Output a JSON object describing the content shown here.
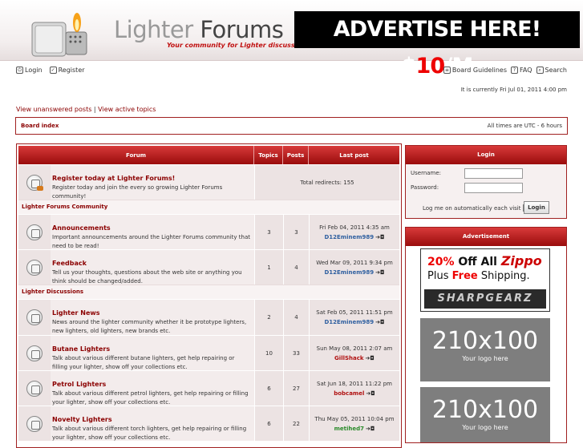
{
  "header": {
    "logo_word1": "Lighter",
    "logo_word2": "Forums",
    "tagline": "Your community for Lighter discussions!",
    "ad_text_pre": "ADVERTISE HERE! $",
    "ad_text_hl": "10",
    "ad_text_post": "/M"
  },
  "nav": {
    "login": "Login",
    "register": "Register",
    "guidelines": "Board Guidelines",
    "faq": "FAQ",
    "search": "Search"
  },
  "current_time": "It is currently Fri Jul 01, 2011 4:00 pm",
  "quick_links": {
    "unanswered": "View unanswered posts",
    "separator": "|",
    "active": "View active topics"
  },
  "crumb": {
    "board_index": "Board index",
    "timezone": "All times are UTC - 6 hours"
  },
  "table": {
    "headers": {
      "forum": "Forum",
      "topics": "Topics",
      "posts": "Posts",
      "last": "Last post"
    },
    "register": {
      "title": "Register today at Lighter Forums!",
      "desc": "Register today and join the every so growing Lighter Forums community!",
      "redirects": "Total redirects: 155"
    },
    "cat1": "Lighter Forums Community",
    "cat2": "Lighter Discussions",
    "forums": [
      {
        "title": "Announcements",
        "desc": "Important announcements around the Lighter Forums community that need to be read!",
        "topics": "3",
        "posts": "3",
        "date": "Fri Feb 04, 2011 4:35 am",
        "by": "D12Eminem989"
      },
      {
        "title": "Feedback",
        "desc": "Tell us your thoughts, questions about the web site or anything you think should be changed/added.",
        "topics": "1",
        "posts": "4",
        "date": "Wed Mar 09, 2011 9:34 pm",
        "by": "D12Eminem989"
      },
      {
        "title": "Lighter News",
        "desc": "News around the lighter community whether it be prototype lighters, new lighters, old lighters, new brands etc.",
        "topics": "2",
        "posts": "4",
        "date": "Sat Feb 05, 2011 11:51 pm",
        "by": "D12Eminem989"
      },
      {
        "title": "Butane Lighters",
        "desc": "Talk about various different butane lighters, get help repairing or filling your lighter, show off your collections etc.",
        "topics": "10",
        "posts": "33",
        "date": "Sun May 08, 2011 2:07 am",
        "by": "GillShack"
      },
      {
        "title": "Petrol Lighters",
        "desc": "Talk about various different petrol lighters, get help repairing or filling your lighter, show off your collections etc.",
        "topics": "6",
        "posts": "27",
        "date": "Sat Jun 18, 2011 11:22 pm",
        "by": "bobcamel"
      },
      {
        "title": "Novelty Lighters",
        "desc": "Talk about various different torch lighters, get help repairing or filling your lighter, show off your collections etc.",
        "topics": "6",
        "posts": "22",
        "date": "Thu May 05, 2011 10:04 pm",
        "by": "metihed7"
      }
    ]
  },
  "login_box": {
    "title": "Login",
    "username_label": "Username:",
    "password_label": "Password:",
    "auto_label": "Log me on automatically each visit",
    "button": "Login"
  },
  "advert": {
    "title": "Advertisement",
    "zippo_pct": "20%",
    "zippo_off": " Off All ",
    "zippo_brand": "Zippo",
    "zippo_plus": "Plus ",
    "zippo_free": "Free",
    "zippo_ship": " Shipping.",
    "sharpgearz": "SHARPGEARZ",
    "ph_size": "210x100",
    "ph_text": "Your logo here"
  },
  "colors": {
    "accent": "#a02020",
    "header_red": "#c02020",
    "link": "#8b0000"
  }
}
